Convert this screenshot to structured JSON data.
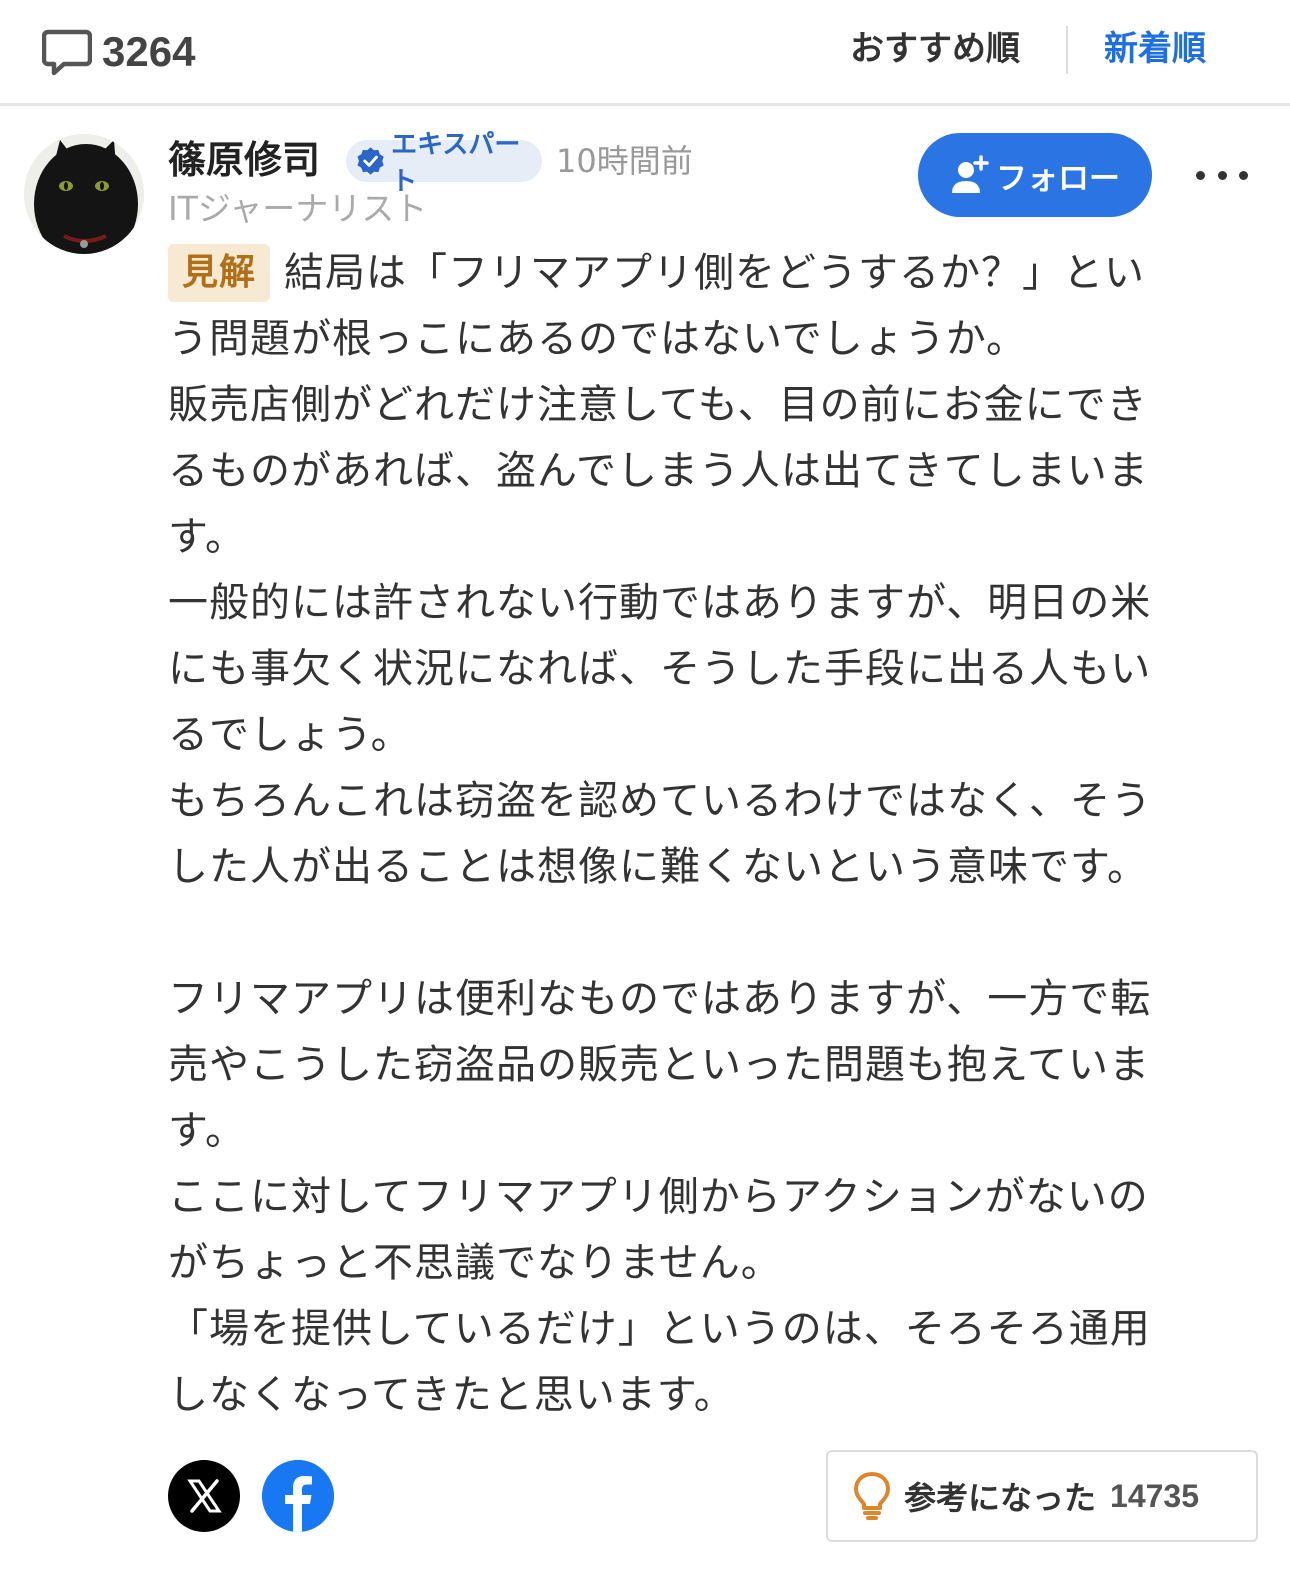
{
  "header": {
    "comment_count": "3264",
    "sort_options": [
      "おすすめ順",
      "新着順"
    ],
    "active_sort": "新着順",
    "active_color": "#1e6fe0"
  },
  "author": {
    "name": "篠原修司",
    "badge": "エキスパート",
    "time": "10時間前",
    "title": "ITジャーナリスト",
    "follow_label": "フォロー"
  },
  "comment": {
    "tag": "見解",
    "lines": [
      "結局は「フリマアプリ側をどうするか？」とい",
      "う問題が根っこにあるのではないでしょうか。",
      "販売店側がどれだけ注意しても、目の前にお金にでき",
      "るものがあれば、盗んでしまう人は出てきてしまいま",
      "す。",
      "一般的には許されない行動ではありますが、明日の米",
      "にも事欠く状況になれば、そうした手段に出る人もい",
      "るでしょう。",
      "もちろんこれは窃盗を認めているわけではなく、そう",
      "した人が出ることは想像に難くないという意味です。",
      "",
      "フリマアプリは便利なものではありますが、一方で転",
      "売やこうした窃盗品の販売といった問題も抱えていま",
      "す。",
      "ここに対してフリマアプリ側からアクションがないの",
      "がちょっと不思議でなりません。",
      "「場を提供しているだけ」というのは、そろそろ通用",
      "しなくなってきたと思います。"
    ]
  },
  "footer": {
    "share_icons": [
      "x-icon",
      "facebook-icon"
    ],
    "helpful_label": "参考になった",
    "helpful_count": "14735",
    "brand_blue": "#2b74e4",
    "bulb_color": "#e0862a"
  }
}
